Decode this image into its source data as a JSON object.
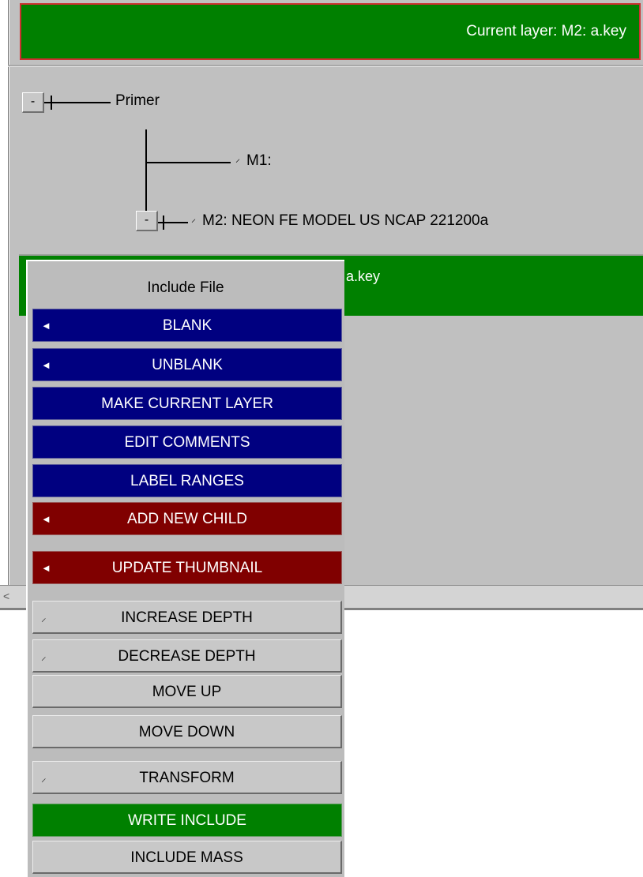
{
  "header": {
    "current_layer": "Current layer: M2: a.key"
  },
  "tree": {
    "root_expander": "-",
    "root_label": "Primer",
    "m1_label": "M1:",
    "m2_expander": "-",
    "m2_label": "M2: NEON FE MODEL US NCAP 221200a",
    "selected_label": "a.key"
  },
  "icons": {
    "submenu_arrow": "◄",
    "depth_arrow": "⸝",
    "scroll_left": "<"
  },
  "menu": {
    "title": "Include File",
    "items": [
      {
        "label": "BLANK",
        "style": "blue",
        "has_submenu": true
      },
      {
        "label": "UNBLANK",
        "style": "blue",
        "has_submenu": true
      },
      {
        "label": "MAKE CURRENT LAYER",
        "style": "blue",
        "has_submenu": false
      },
      {
        "label": "EDIT COMMENTS",
        "style": "blue",
        "has_submenu": false
      },
      {
        "label": "LABEL RANGES",
        "style": "blue",
        "has_submenu": false
      },
      {
        "label": "ADD NEW CHILD",
        "style": "red",
        "has_submenu": true
      },
      {
        "label": "UPDATE THUMBNAIL",
        "style": "red",
        "has_submenu": true
      },
      {
        "label": "INCREASE DEPTH",
        "style": "grey",
        "has_submenu": true
      },
      {
        "label": "DECREASE DEPTH",
        "style": "grey",
        "has_submenu": true
      },
      {
        "label": "MOVE UP",
        "style": "grey",
        "has_submenu": false
      },
      {
        "label": "MOVE DOWN",
        "style": "grey",
        "has_submenu": false
      },
      {
        "label": "TRANSFORM",
        "style": "grey",
        "has_submenu": true
      },
      {
        "label": "WRITE INCLUDE",
        "style": "green",
        "has_submenu": false
      },
      {
        "label": "INCLUDE MASS",
        "style": "grey",
        "has_submenu": false
      }
    ]
  },
  "colors": {
    "blue_item": "#000080",
    "red_item": "#800000",
    "green_item": "#008000",
    "panel": "#c0c0c0"
  }
}
